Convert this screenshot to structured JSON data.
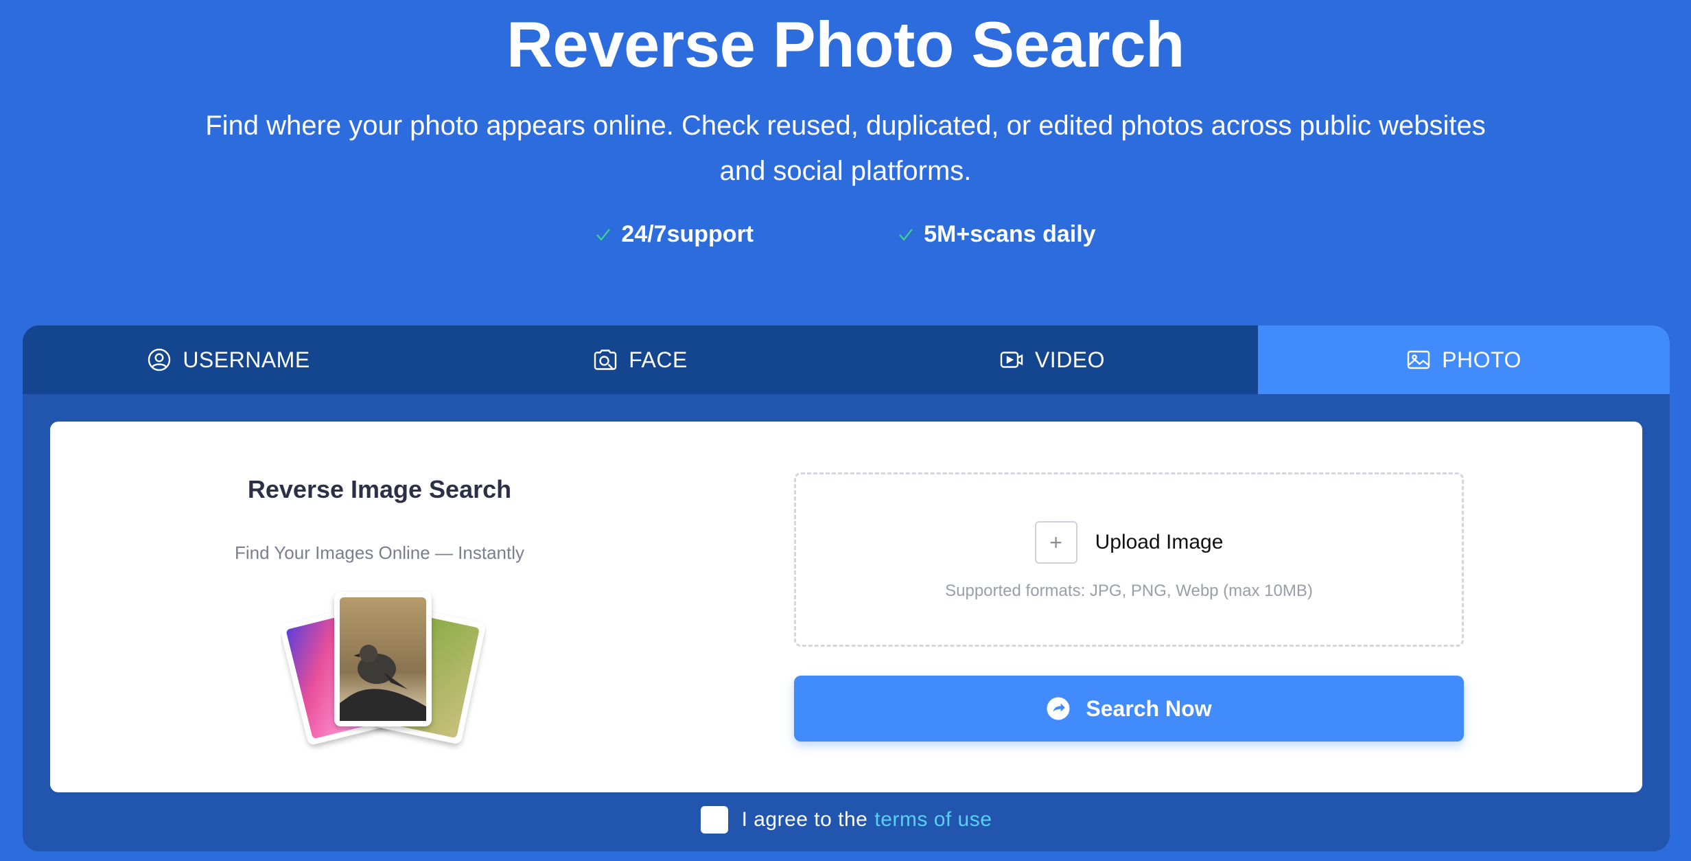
{
  "hero": {
    "title": "Reverse Photo Search",
    "subtitle_line1": "Find where your photo appears online. Check reused, duplicated, or edited photos across public websites",
    "subtitle_line2": "and social platforms.",
    "features": [
      "24/7support",
      "5M+scans daily"
    ]
  },
  "tabs": [
    {
      "label": "USERNAME",
      "icon": "user-circle-icon"
    },
    {
      "label": "FACE",
      "icon": "face-scan-icon"
    },
    {
      "label": "VIDEO",
      "icon": "video-icon"
    },
    {
      "label": "PHOTO",
      "icon": "image-icon",
      "active": true
    }
  ],
  "panel": {
    "title": "Reverse Image Search",
    "subtitle": "Find Your Images Online — Instantly",
    "upload_label": "Upload Image",
    "formats": "Supported formats: JPG, PNG, Webp (max 10MB)",
    "search_label": "Search Now"
  },
  "agree": {
    "prefix": "I agree to the",
    "link": "terms of use"
  },
  "colors": {
    "background": "#2d6cdc",
    "tab_bar": "#14458f",
    "active_tab": "#418bfc",
    "card": "#2256ae",
    "check": "#3ed58a",
    "link": "#59d0f5"
  }
}
